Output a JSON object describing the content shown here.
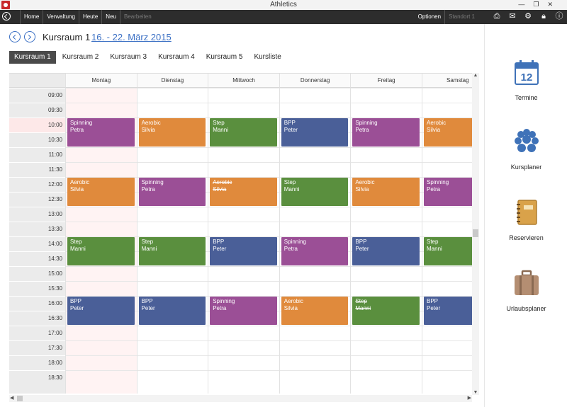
{
  "window": {
    "title": "Athletics"
  },
  "menu": {
    "items": [
      "Home",
      "Verwaltung",
      "Heute",
      "Neu"
    ],
    "disabled_item": "Bearbeiten",
    "right_items": [
      "Optionen",
      "Standort 1"
    ]
  },
  "header": {
    "room": "Kursraum 1",
    "date_range": "16. - 22. März 2015"
  },
  "tabs": [
    "Kursraum 1",
    "Kursraum 2",
    "Kursraum 3",
    "Kursraum 4",
    "Kursraum 5",
    "Kursliste"
  ],
  "active_tab": 0,
  "calendar": {
    "days": [
      "Montag",
      "Dienstag",
      "Mittwoch",
      "Donnerstag",
      "Freitag",
      "Samstag"
    ],
    "times": [
      "09:00",
      "09:30",
      "10:00",
      "10:30",
      "11:00",
      "11:30",
      "12:00",
      "12:30",
      "13:00",
      "13:30",
      "14:00",
      "14:30",
      "15:00",
      "15:30",
      "16:00",
      "16:30",
      "17:00",
      "17:30",
      "18:00",
      "18:30"
    ],
    "highlight_time": "10:00",
    "events": [
      {
        "day": 0,
        "start": "10:00",
        "course": "Spinning",
        "trainer": "Petra",
        "color": "#9b4f96",
        "cancelled": false
      },
      {
        "day": 1,
        "start": "10:00",
        "course": "Aerobic",
        "trainer": "Silvia",
        "color": "#e08a3c",
        "cancelled": false
      },
      {
        "day": 2,
        "start": "10:00",
        "course": "Step",
        "trainer": "Manni",
        "color": "#5a8f3e",
        "cancelled": false
      },
      {
        "day": 3,
        "start": "10:00",
        "course": "BPP",
        "trainer": "Peter",
        "color": "#4a5f98",
        "cancelled": false
      },
      {
        "day": 4,
        "start": "10:00",
        "course": "Spinning",
        "trainer": "Petra",
        "color": "#9b4f96",
        "cancelled": false
      },
      {
        "day": 5,
        "start": "10:00",
        "course": "Aerobic",
        "trainer": "Silvia",
        "color": "#e08a3c",
        "cancelled": false
      },
      {
        "day": 0,
        "start": "12:00",
        "course": "Aerobic",
        "trainer": "Silvia",
        "color": "#e08a3c",
        "cancelled": false
      },
      {
        "day": 1,
        "start": "12:00",
        "course": "Spinning",
        "trainer": "Petra",
        "color": "#9b4f96",
        "cancelled": false
      },
      {
        "day": 2,
        "start": "12:00",
        "course": "Aerobic",
        "trainer": "Silvia",
        "color": "#e08a3c",
        "cancelled": true
      },
      {
        "day": 3,
        "start": "12:00",
        "course": "Step",
        "trainer": "Manni",
        "color": "#5a8f3e",
        "cancelled": false
      },
      {
        "day": 4,
        "start": "12:00",
        "course": "Aerobic",
        "trainer": "Silvia",
        "color": "#e08a3c",
        "cancelled": false
      },
      {
        "day": 5,
        "start": "12:00",
        "course": "Spinning",
        "trainer": "Petra",
        "color": "#9b4f96",
        "cancelled": false
      },
      {
        "day": 0,
        "start": "14:00",
        "course": "Step",
        "trainer": "Manni",
        "color": "#5a8f3e",
        "cancelled": false
      },
      {
        "day": 1,
        "start": "14:00",
        "course": "Step",
        "trainer": "Manni",
        "color": "#5a8f3e",
        "cancelled": false
      },
      {
        "day": 2,
        "start": "14:00",
        "course": "BPP",
        "trainer": "Peter",
        "color": "#4a5f98",
        "cancelled": false
      },
      {
        "day": 3,
        "start": "14:00",
        "course": "Spinning",
        "trainer": "Petra",
        "color": "#9b4f96",
        "cancelled": false
      },
      {
        "day": 4,
        "start": "14:00",
        "course": "BPP",
        "trainer": "Peter",
        "color": "#4a5f98",
        "cancelled": false
      },
      {
        "day": 5,
        "start": "14:00",
        "course": "Step",
        "trainer": "Manni",
        "color": "#5a8f3e",
        "cancelled": false
      },
      {
        "day": 0,
        "start": "16:00",
        "course": "BPP",
        "trainer": "Peter",
        "color": "#4a5f98",
        "cancelled": false
      },
      {
        "day": 1,
        "start": "16:00",
        "course": "BPP",
        "trainer": "Peter",
        "color": "#4a5f98",
        "cancelled": false
      },
      {
        "day": 2,
        "start": "16:00",
        "course": "Spinning",
        "trainer": "Petra",
        "color": "#9b4f96",
        "cancelled": false
      },
      {
        "day": 3,
        "start": "16:00",
        "course": "Aerobic",
        "trainer": "Silvia",
        "color": "#e08a3c",
        "cancelled": false
      },
      {
        "day": 4,
        "start": "16:00",
        "course": "Step",
        "trainer": "Manni",
        "color": "#5a8f3e",
        "cancelled": true
      },
      {
        "day": 5,
        "start": "16:00",
        "course": "BPP",
        "trainer": "Peter",
        "color": "#4a5f98",
        "cancelled": false
      }
    ]
  },
  "side_panel": {
    "items": [
      {
        "label": "Termine",
        "icon": "calendar-icon"
      },
      {
        "label": "Kursplaner",
        "icon": "group-icon"
      },
      {
        "label": "Reservieren",
        "icon": "notebook-icon"
      },
      {
        "label": "Urlaubsplaner",
        "icon": "suitcase-icon"
      }
    ],
    "calendar_icon_number": "12"
  },
  "colors": {
    "menubar": "#2d2d2d",
    "accent": "#3a6fc4",
    "spinning": "#9b4f96",
    "aerobic": "#e08a3c",
    "step": "#5a8f3e",
    "bpp": "#4a5f98"
  }
}
